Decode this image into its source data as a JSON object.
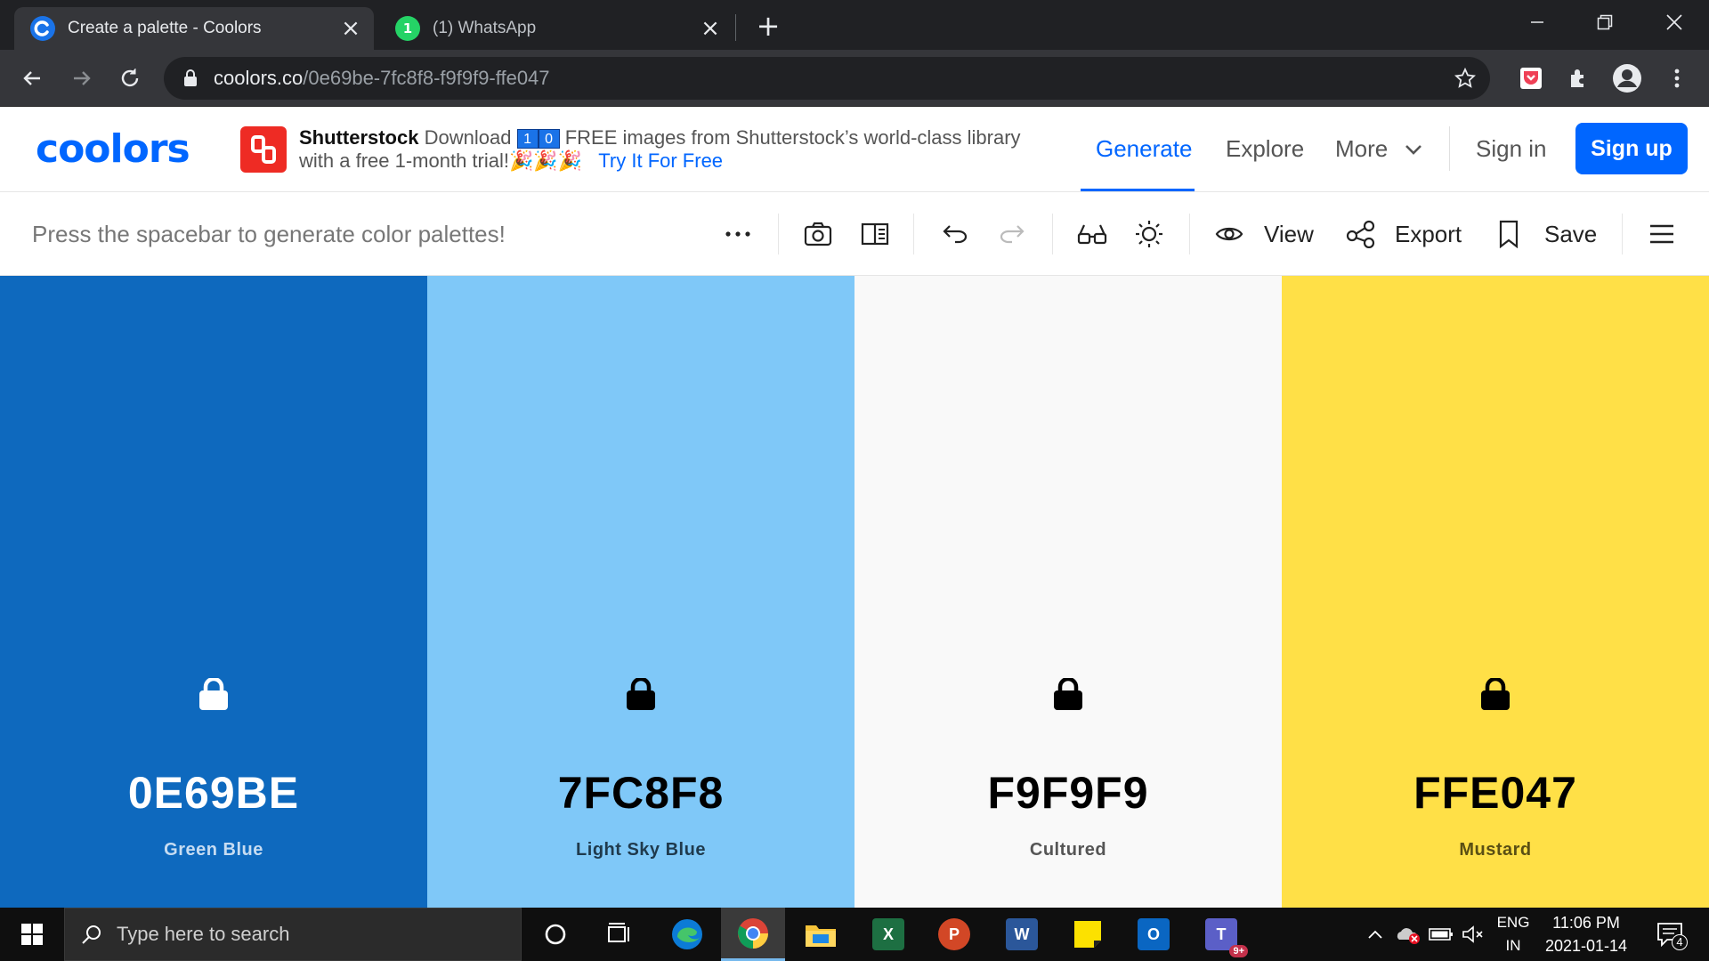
{
  "browser": {
    "tabs": [
      {
        "title": "Create a palette - Coolors",
        "icon": "coolors-favicon"
      },
      {
        "title": "(1) WhatsApp",
        "icon": "whatsapp-favicon",
        "badge": "1"
      }
    ],
    "address": {
      "host": "coolors.co",
      "path": "/0e69be-7fc8f8-f9f9f9-ffe047"
    }
  },
  "site": {
    "logo": "coolors",
    "ad": {
      "brand": "Shutterstock",
      "text_before": "Download",
      "digits": [
        "1",
        "0"
      ],
      "text_after": "FREE images from Shutterstock’s world-class library with a free 1-month trial!",
      "emoji": "🎉🎉🎉",
      "cta": "Try It For Free"
    },
    "nav": {
      "generate": "Generate",
      "explore": "Explore",
      "more": "More",
      "signin": "Sign in",
      "signup": "Sign up"
    }
  },
  "toolbar": {
    "hint": "Press the spacebar to generate color palettes!",
    "view": "View",
    "export": "Export",
    "save": "Save"
  },
  "palette": [
    {
      "hex": "0E69BE",
      "name": "Green Blue",
      "color": "#0E69BE",
      "text_color": "#ffffff",
      "name_color": "#c6dcf2",
      "lock_color": "#ffffff"
    },
    {
      "hex": "7FC8F8",
      "name": "Light Sky Blue",
      "color": "#7FC8F8",
      "text_color": "#000000",
      "name_color": "#1f3a4d",
      "lock_color": "#000000"
    },
    {
      "hex": "F9F9F9",
      "name": "Cultured",
      "color": "#F9F9F9",
      "text_color": "#000000",
      "name_color": "#555555",
      "lock_color": "#000000"
    },
    {
      "hex": "FFE047",
      "name": "Mustard",
      "color": "#FFE047",
      "text_color": "#000000",
      "name_color": "#5a4f14",
      "lock_color": "#000000"
    }
  ],
  "taskbar": {
    "search_placeholder": "Type here to search",
    "teams_badge": "9+",
    "lang_top": "ENG",
    "lang_bottom": "IN",
    "time": "11:06 PM",
    "date": "2021-01-14",
    "notifications": "4"
  }
}
